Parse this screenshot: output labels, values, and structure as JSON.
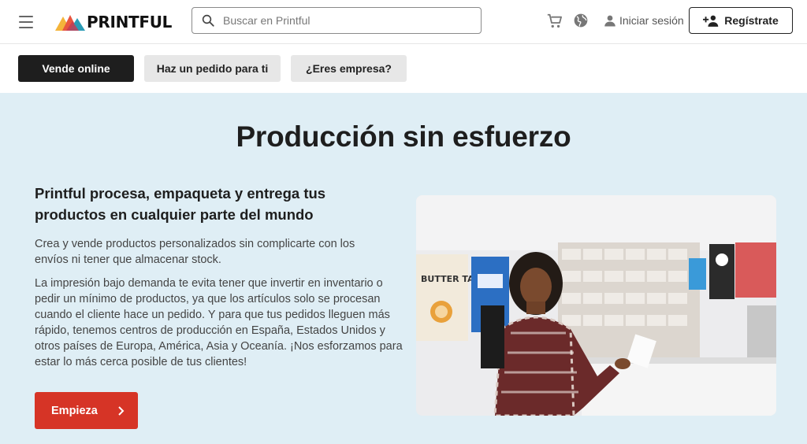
{
  "header": {
    "brand": "PRINTFUL",
    "search_placeholder": "Buscar en Printful",
    "login_label": "Iniciar sesión",
    "register_label": "Regístrate"
  },
  "subnav": {
    "items": [
      {
        "label": "Vende online",
        "active": true
      },
      {
        "label": "Haz un pedido para ti",
        "active": false
      },
      {
        "label": "¿Eres empresa?",
        "active": false
      }
    ]
  },
  "hero": {
    "title": "Producción sin esfuerzo",
    "subtitle": "Printful procesa, empaqueta y entrega tus productos en cualquier parte del mundo",
    "paragraph1": "Crea y vende productos personalizados sin complicarte con los envíos ni tener que almacenar stock.",
    "paragraph2": "La impresión bajo demanda te evita tener que invertir en inventario o pedir un mínimo de productos, ya que los artículos solo se procesan cuando el cliente hace un pedido. Y para que tus pedidos lleguen más rápido, tenemos centros de producción en España, Estados Unidos y otros países de Europa, América, Asia y Oceanía. ¡Nos esforzamos para estar lo más cerca posible de tus clientes!",
    "cta_label": "Empieza",
    "poster_text": "BUTTER TARTS!"
  },
  "colors": {
    "cta": "#d63426",
    "hero_bg": "#dfeef5",
    "active_pill": "#1e1e1e",
    "inactive_pill": "#e7e7e7"
  },
  "icons": [
    "menu-icon",
    "printful-logo",
    "search-icon",
    "cart-icon",
    "globe-icon",
    "user-icon",
    "add-user-icon",
    "chevron-right-icon"
  ]
}
